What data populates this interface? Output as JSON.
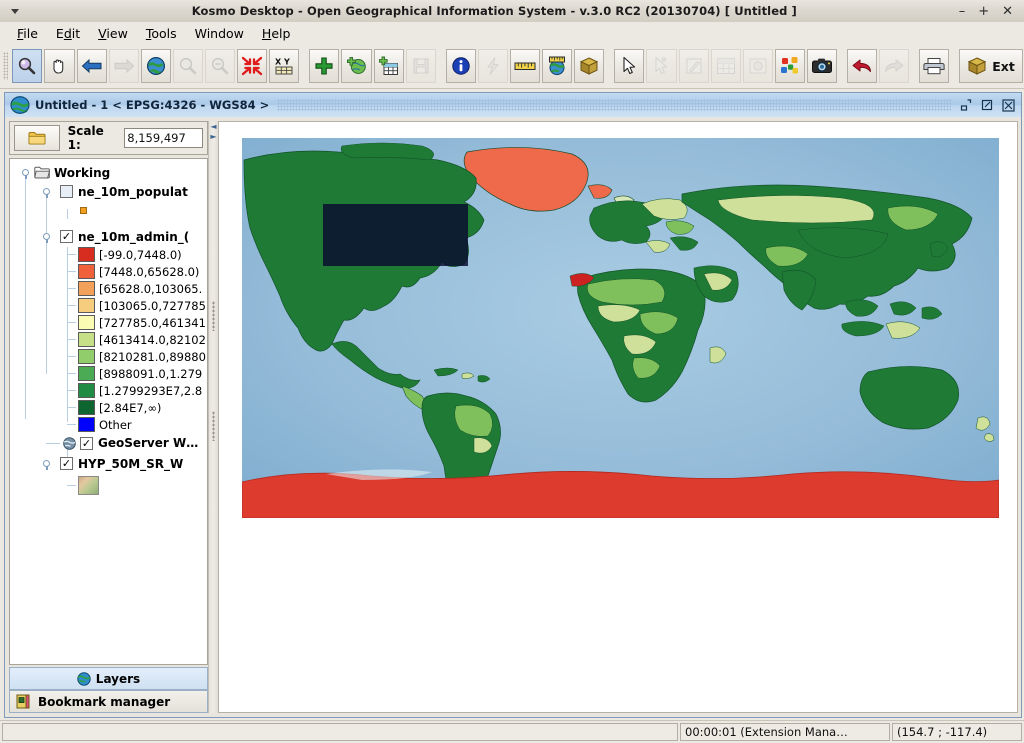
{
  "window": {
    "title": "Kosmo Desktop - Open Geographical Information System - v.3.0 RC2 (20130704)  [ Untitled ]",
    "minimize_label": "–",
    "maximize_label": "+",
    "close_label": "✕",
    "menu_caret_name": "window-menu-caret"
  },
  "menubar": {
    "items": [
      {
        "label": "File",
        "mnemonic": "F"
      },
      {
        "label": "Edit",
        "mnemonic": "E"
      },
      {
        "label": "View",
        "mnemonic": "V"
      },
      {
        "label": "Tools",
        "mnemonic": "T"
      },
      {
        "label": "Window",
        "mnemonic": "W"
      },
      {
        "label": "Help",
        "mnemonic": "H"
      }
    ]
  },
  "toolbar": {
    "ext_button_label": "Ext",
    "buttons": [
      {
        "name": "zoom-tool-button",
        "icon": "magnifier-icon",
        "state": "selected"
      },
      {
        "name": "pan-tool-button",
        "icon": "hand-icon",
        "state": "normal"
      },
      {
        "name": "previous-extent-button",
        "icon": "arrow-left-icon",
        "state": "normal"
      },
      {
        "name": "next-extent-button",
        "icon": "arrow-right-icon",
        "state": "disabled"
      },
      {
        "name": "zoom-full-extent-button",
        "icon": "globe-icon",
        "state": "normal"
      },
      {
        "name": "zoom-in-button",
        "icon": "magnifier-plus-icon",
        "state": "disabled"
      },
      {
        "name": "zoom-out-button",
        "icon": "magnifier-minus-icon",
        "state": "disabled"
      },
      {
        "name": "zoom-to-selection-button",
        "icon": "arrows-inward-icon",
        "state": "normal"
      },
      {
        "name": "goto-xy-button",
        "icon": "xy-coordinates-icon",
        "state": "normal"
      },
      {
        "name": "add-layer-button",
        "icon": "green-plus-icon",
        "state": "normal"
      },
      {
        "name": "add-wms-layer-button",
        "icon": "globe-plus-icon",
        "state": "normal"
      },
      {
        "name": "add-table-layer-button",
        "icon": "table-plus-icon",
        "state": "normal"
      },
      {
        "name": "save-layer-button",
        "icon": "save-disk-icon",
        "state": "disabled"
      },
      {
        "name": "feature-info-button",
        "icon": "info-icon",
        "state": "normal"
      },
      {
        "name": "quick-query-button",
        "icon": "lightning-icon",
        "state": "disabled"
      },
      {
        "name": "measure-distance-button",
        "icon": "ruler-icon",
        "state": "normal"
      },
      {
        "name": "measure-geodesic-button",
        "icon": "globe-ruler-icon",
        "state": "normal"
      },
      {
        "name": "3d-view-button",
        "icon": "box-3d-icon",
        "state": "normal"
      },
      {
        "name": "select-tool-button",
        "icon": "cursor-arrow-icon",
        "state": "normal"
      },
      {
        "name": "select-node-button",
        "icon": "cursor-node-icon",
        "state": "disabled"
      },
      {
        "name": "edit-geometry-button",
        "icon": "pencil-square-icon",
        "state": "disabled"
      },
      {
        "name": "attribute-table-button",
        "icon": "grid-table-icon",
        "state": "disabled"
      },
      {
        "name": "snapshot-button",
        "icon": "photo-icon",
        "state": "disabled"
      },
      {
        "name": "symbology-button",
        "icon": "color-dots-icon",
        "state": "normal"
      },
      {
        "name": "map-capture-button",
        "icon": "camera-icon",
        "state": "normal"
      },
      {
        "name": "undo-button",
        "icon": "undo-arrow-icon",
        "state": "normal"
      },
      {
        "name": "redo-button",
        "icon": "redo-arrow-icon",
        "state": "disabled"
      },
      {
        "name": "print-button",
        "icon": "printer-icon",
        "state": "normal"
      },
      {
        "name": "extensions-button",
        "icon": "box-package-icon",
        "state": "normal"
      }
    ]
  },
  "internal_window": {
    "title": "Untitled - 1 < EPSG:4326 - WGS84 >",
    "icon": "globe-icon",
    "minimize_name": "iframe-minimize-button",
    "maximize_name": "iframe-maximize-button",
    "close_name": "iframe-close-button"
  },
  "left_panel": {
    "folder_button_icon": "folder-icon",
    "scale_label": "Scale 1:",
    "scale_value": "8,159,497",
    "tree": {
      "root": {
        "label": "Working",
        "icon": "folder-open-icon",
        "expanded": true
      },
      "layers": [
        {
          "label": "ne_10m_populat",
          "checked": false,
          "symbol_color": "#f0a01e",
          "symbol_shape": "square-small"
        },
        {
          "label": "ne_10m_admin_(",
          "checked": true,
          "legend": [
            {
              "label": "[-99.0,7448.0)",
              "color": "#d62d20"
            },
            {
              "label": "[7448.0,65628.0)",
              "color": "#f0603a"
            },
            {
              "label": "[65628.0,103065.",
              "color": "#f2a05a"
            },
            {
              "label": "[103065.0,727785",
              "color": "#f6cd7e"
            },
            {
              "label": "[727785.0,461341",
              "color": "#fbfbb4"
            },
            {
              "label": "[4613414.0,82102",
              "color": "#c6e088"
            },
            {
              "label": "[8210281.0,89880",
              "color": "#92cd6b"
            },
            {
              "label": "[8988091.0,1.279",
              "color": "#4aab54"
            },
            {
              "label": "[1.2799293E7,2.8",
              "color": "#1f8b43"
            },
            {
              "label": "[2.84E7,∞)",
              "color": "#0d6630"
            },
            {
              "label": "Other",
              "color": "#0000ff"
            }
          ]
        },
        {
          "label": "GeoServer W…",
          "checked": true,
          "icon": "globe-icon",
          "is_wms": true
        },
        {
          "label": "HYP_50M_SR_W",
          "checked": true,
          "raster_preview": true
        }
      ]
    },
    "tabs": [
      {
        "label": "Layers",
        "icon": "globe-icon",
        "active": true
      },
      {
        "label": "Bookmark manager",
        "icon": "book-icon",
        "active": false
      }
    ]
  },
  "splitter": {
    "collapse_left_arrow": "◄",
    "collapse_right_arrow": "►"
  },
  "map": {
    "selection_box_color": "#080a30",
    "ocean_color": "#96bcd9",
    "antarctica_color": "#dc3b2e",
    "greenland_color": "#ef6a4a"
  },
  "statusbar": {
    "message": "",
    "timer": "00:00:01 (Extension Mana…",
    "coordinates": "(154.7 ; -117.4)"
  }
}
